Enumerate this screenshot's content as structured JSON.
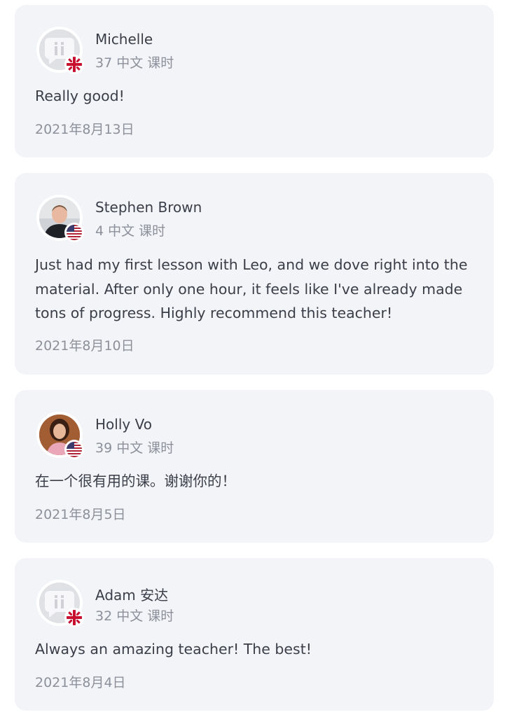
{
  "reviews": [
    {
      "name": "Michelle",
      "lessons": "37 中文 课时",
      "text": "Really good!",
      "date": "2021年8月13日",
      "avatar": "default-avatar",
      "flag": "uk-flag-icon"
    },
    {
      "name": "Stephen Brown",
      "lessons": "4 中文 课时",
      "text": "Just had my first lesson with Leo, and we dove right into the material. After only one hour, it feels like I've already made tons of progress. Highly recommend this teacher!",
      "date": "2021年8月10日",
      "avatar": "user-photo",
      "flag": "us-flag-icon"
    },
    {
      "name": "Holly Vo",
      "lessons": "39 中文 课时",
      "text": "在一个很有用的课。谢谢你的！",
      "date": "2021年8月5日",
      "avatar": "user-photo",
      "flag": "us-flag-icon"
    },
    {
      "name": "Adam 安达",
      "lessons": "32 中文 课时",
      "text": "Always an amazing teacher! The best!",
      "date": "2021年8月4日",
      "avatar": "default-avatar",
      "flag": "uk-flag-icon"
    }
  ],
  "colors": {
    "card_background": "#f3f4f8",
    "primary_text": "#3b3e48",
    "secondary_text": "#8d909a"
  }
}
